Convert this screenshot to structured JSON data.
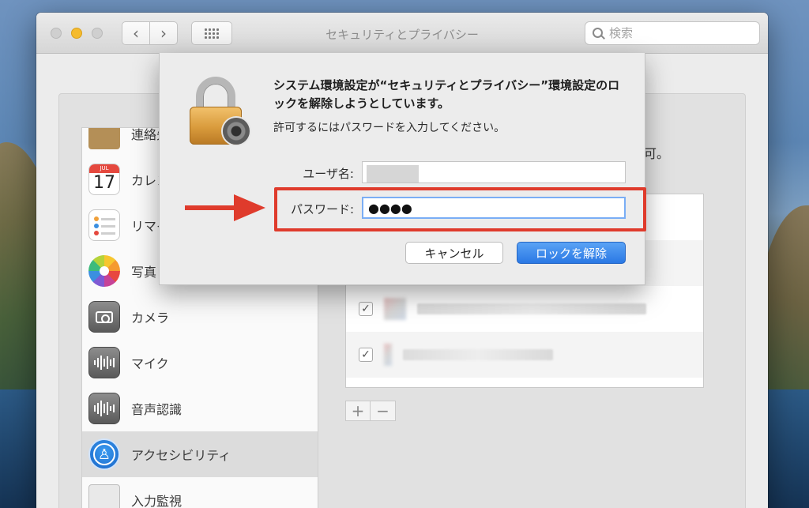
{
  "window": {
    "title": "セキュリティとプライバシー",
    "search_placeholder": "検索",
    "nav_back": "‹",
    "nav_forward": "›"
  },
  "sidebar": {
    "items": [
      {
        "label": "連絡先",
        "icon": "contacts-icon"
      },
      {
        "label": "カレンダー",
        "icon": "calendar-icon",
        "icon_month": "JUL",
        "icon_day": "17"
      },
      {
        "label": "リマインダー",
        "icon": "reminders-icon"
      },
      {
        "label": "写真",
        "icon": "photos-icon"
      },
      {
        "label": "カメラ",
        "icon": "camera-icon"
      },
      {
        "label": "マイク",
        "icon": "microphone-icon"
      },
      {
        "label": "音声認識",
        "icon": "speech-recognition-icon"
      },
      {
        "label": "アクセシビリティ",
        "icon": "accessibility-icon",
        "selected": true
      },
      {
        "label": "入力監視",
        "icon": "keyboard-icon"
      }
    ]
  },
  "main": {
    "clipped_text": "可。",
    "check_mark": "✓",
    "plus_label": "+",
    "minus_label": "−"
  },
  "auth_dialog": {
    "title": "システム環境設定が“セキュリティとプライバシー”環境設定のロックを解除しようとしています。",
    "message": "許可するにはパスワードを入力してください。",
    "username_label": "ユーザ名:",
    "password_label": "パスワード:",
    "password_value": "●●●●",
    "cancel_label": "キャンセル",
    "unlock_label": "ロックを解除"
  },
  "colors": {
    "highlight": "#df3b2c",
    "primary_button": "#2a78e4"
  }
}
